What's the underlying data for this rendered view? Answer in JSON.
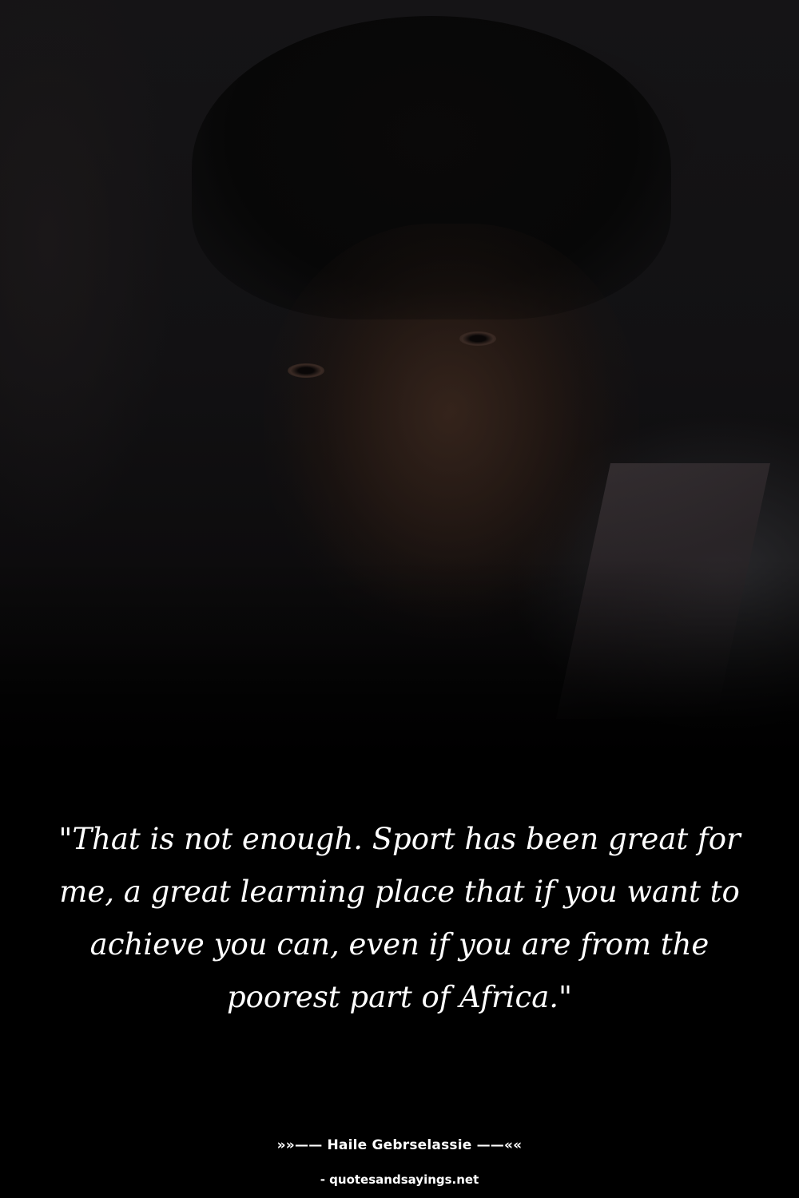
{
  "quote": {
    "text": "\"That is not enough. Sport has been great for me, a great learning place that if you want to achieve you can, even if you are from the poorest part of Africa.\""
  },
  "author": {
    "line": "»»—— Haile Gebrselassie ——««"
  },
  "source": {
    "line": "- quotesandsayings.net"
  },
  "colors": {
    "background": "#000000",
    "text": "#ffffff"
  }
}
